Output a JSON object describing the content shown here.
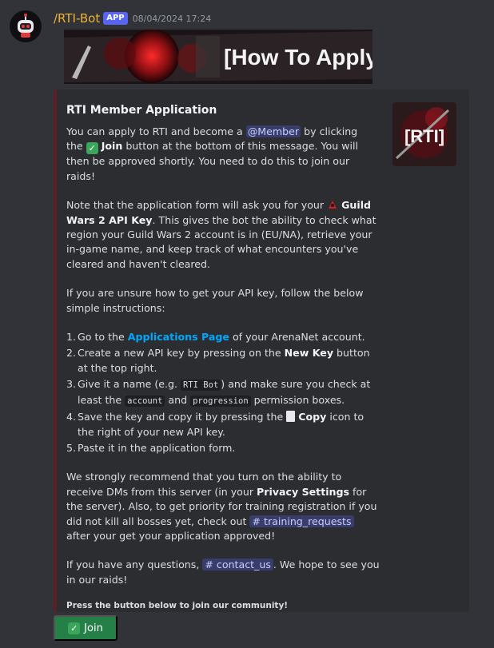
{
  "message": {
    "author": "/RTI-Bot",
    "badge": "APP",
    "timestamp": "08/04/2024 17:24",
    "banner_text": "[How To Apply]"
  },
  "embed": {
    "title": "RTI Member Application",
    "thumbnail_text": "[RTI]",
    "accent_color": "#5d1f24",
    "p1": {
      "a": "You can apply to RTI and become a ",
      "mention": "@Member",
      "b": " by clicking the ",
      "join": "Join",
      "c": " button at the bottom of this message. You will then be approved shortly. You need to do this to join our raids!"
    },
    "p2": {
      "a": "Note that the application form will ask you for your ",
      "key": "Guild Wars 2 API Key",
      "b": ". This gives the bot the ability to check what region your Guild Wars 2 account is in (EU/NA), retrieve your in-game name, and keep track of what encounters you've cleared and haven't cleared."
    },
    "p3": "If you are unsure how to get your API key, follow the below simple instructions:",
    "steps": {
      "s1": {
        "num": "1.",
        "a": "Go to the ",
        "link": "Applications Page",
        "b": " of your ArenaNet account."
      },
      "s2": {
        "num": "2.",
        "a": "Create a new API key by pressing on the ",
        "bold": "New Key",
        "b": " button at the top right."
      },
      "s3": {
        "num": "3.",
        "a": "Give it a name (e.g. ",
        "code1": "RTI Bot",
        "b": ") and make sure you check at least the ",
        "code2": "account",
        "c": " and ",
        "code3": "progression",
        "d": " permission boxes."
      },
      "s4": {
        "num": "4.",
        "a": "Save the key and copy it by pressing the ",
        "bold": "Copy",
        "b": " icon to the right of your new API key."
      },
      "s5": {
        "num": "5.",
        "a": "Paste it in the application form."
      }
    },
    "p4": {
      "a": "We strongly recommend that you turn on the ability to receive DMs from this server (in your ",
      "bold": "Privacy Settings",
      "b": " for the server). Also, to get priority for training registration if you did not kill all bosses yet, check out ",
      "channel": "training_requests",
      "c": " after your get your application approved!"
    },
    "p5": {
      "a": "If you have any questions, ",
      "channel": "contact_us",
      "b": ". We hope to see you in our raids!"
    },
    "footer": "Press the button below to join our community!"
  },
  "button": {
    "label": "Join",
    "color": "#248046"
  },
  "icons": {
    "check": "✓",
    "hash": "#"
  }
}
